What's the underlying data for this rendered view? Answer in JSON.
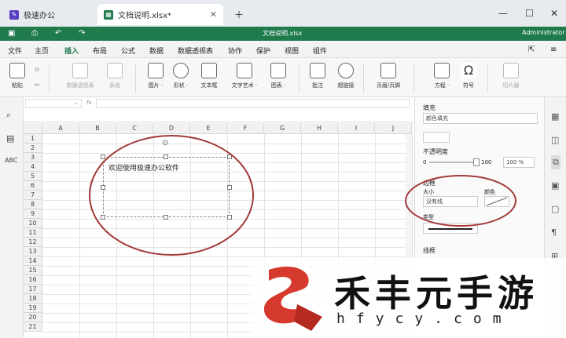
{
  "tabs": [
    {
      "label": "极速办公",
      "active": false
    },
    {
      "label": "文档说明.xlsx*",
      "active": true
    }
  ],
  "window": {
    "user": "Administrator",
    "file_title": "文档说明.xlsx"
  },
  "menu": [
    "文件",
    "主页",
    "插入",
    "布局",
    "公式",
    "数据",
    "数据透视表",
    "协作",
    "保护",
    "视图",
    "组件"
  ],
  "menu_active": "插入",
  "ribbon": [
    {
      "label": "粘贴",
      "dim": false
    },
    {
      "label": "数据透视表",
      "dim": true
    },
    {
      "label": "表格",
      "dim": true
    },
    {
      "label": "图片 ·",
      "dim": false
    },
    {
      "label": "形状 ·",
      "dim": false
    },
    {
      "label": "文本框",
      "dim": false
    },
    {
      "label": "文字艺术 ·",
      "dim": false
    },
    {
      "label": "图表 ·",
      "dim": false
    },
    {
      "label": "批注",
      "dim": false
    },
    {
      "label": "超链接",
      "dim": false
    },
    {
      "label": "页眉/页脚",
      "dim": false
    },
    {
      "label": "方程 ·",
      "dim": false
    },
    {
      "label": "符号",
      "dim": false
    },
    {
      "label": "切片器",
      "dim": true
    }
  ],
  "formula": {
    "fx": "fx"
  },
  "grid": {
    "columns": [
      "A",
      "B",
      "C",
      "D",
      "E",
      "F",
      "G",
      "H",
      "I",
      "J"
    ],
    "rows": [
      "1",
      "2",
      "3",
      "4",
      "5",
      "6",
      "7",
      "8",
      "9",
      "10",
      "11",
      "12",
      "13",
      "14",
      "15",
      "16",
      "17",
      "18",
      "19",
      "20",
      "21"
    ]
  },
  "textbox": {
    "text": "欢迎使用极速办公软件"
  },
  "panel": {
    "fill_title": "填充",
    "fill_type": "颜色填充",
    "opacity_label": "不透明度",
    "opacity_min": "0",
    "opacity_max": "100",
    "opacity_value": "100 %",
    "border_title": "边框",
    "size_label": "大小",
    "size_value": "没有线",
    "color_label": "颜色",
    "type_label": "类型",
    "extra_label": "线框"
  },
  "watermark": {
    "text": "禾丰元手游",
    "url": "hfycy.com"
  },
  "colors": {
    "accent": "#1f7a4c",
    "annotation": "#a33a3a"
  }
}
